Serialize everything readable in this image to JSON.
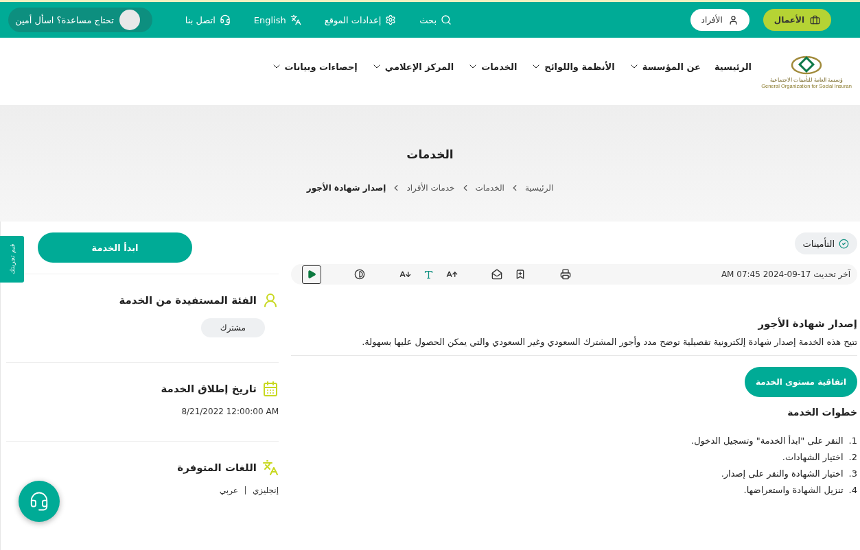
{
  "top_bar": {
    "audiences": [
      {
        "label": "الأعمال",
        "kind": "business",
        "selected": true
      },
      {
        "label": "الأفراد",
        "kind": "person",
        "selected": false
      }
    ],
    "links": [
      {
        "label": "بحث",
        "kind": "search"
      },
      {
        "label": "إعدادات الموقع",
        "kind": "settings"
      },
      {
        "label": "English",
        "kind": "language"
      },
      {
        "label": "اتصل بنا",
        "kind": "headset"
      }
    ],
    "help": {
      "label": "تحتاج مساعدة؟ اسأل أمين"
    }
  },
  "logo": {
    "arabic": "ؤسسة العامة للتأمينات الاجتماعية",
    "english": "General Organization for Social Insuran"
  },
  "nav": [
    {
      "label": "الرئيسية",
      "dropdown": false
    },
    {
      "label": "عن المؤسسة",
      "dropdown": true
    },
    {
      "label": "الأنظمة واللوائح",
      "dropdown": true
    },
    {
      "label": "الخدمات",
      "dropdown": true
    },
    {
      "label": "المركز الإعلامي",
      "dropdown": true
    },
    {
      "label": "إحصاءات وبيانات",
      "dropdown": true
    }
  ],
  "hero": {
    "title": "الخدمات",
    "breadcrumb": [
      {
        "label": "الرئيسية",
        "current": false
      },
      {
        "label": "الخدمات",
        "current": false
      },
      {
        "label": "خدمات الأفراد",
        "current": false
      },
      {
        "label": "إصدار شهادة الأجور",
        "current": true
      }
    ]
  },
  "main": {
    "tag": "التأمينات",
    "last_updated": "آخر تحديث 17-09-2024 07:45 AM",
    "title": "إصدار شهادة الأجور",
    "description": "تتيح هذه الخدمة إصدار شهادة إلكترونية تفصيلية توضح مدد وأجور المشترك السعودي وغير السعودي والتي يمكن الحصول عليها بسهولة.",
    "sla_button": "اتفاقية مستوى الخدمة",
    "steps_title": "خطوات الخدمة",
    "steps": [
      {
        "number": "1.",
        "text": "النقر على \"ابدأ الخدمة\" وتسجيل الدخول."
      },
      {
        "number": "2.",
        "text": "اختيار الشهادات."
      },
      {
        "number": "3.",
        "text": "اختيار الشهادة والنقر على إصدار."
      },
      {
        "number": "4.",
        "text": "تنزيل الشهادة واستعراضها."
      }
    ]
  },
  "sidebar": {
    "start_button": "ابدأ الخدمة",
    "sections": [
      {
        "kind": "audience",
        "title": "الفئة المستفيدة من الخدمة",
        "values": [
          "مشترك"
        ]
      },
      {
        "kind": "date",
        "title": "تاريخ إطلاق الخدمة",
        "values": [
          "8/21/2022 12:00:00 AM"
        ]
      },
      {
        "kind": "languages",
        "title": "اللغات المتوفرة",
        "values": [
          "إنجليزي",
          "عربي"
        ]
      }
    ]
  },
  "feedback_tab": "قيم تجربتك"
}
